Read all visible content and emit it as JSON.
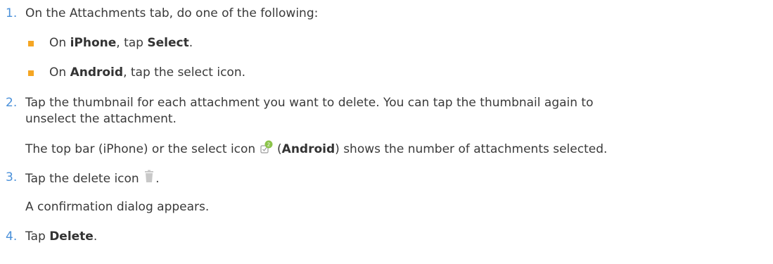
{
  "steps": [
    {
      "number": "1.",
      "text": "On the Attachments tab, do one of the following:",
      "sub": [
        {
          "pre": "On ",
          "bold": "iPhone",
          "mid": ", tap ",
          "bold2": "Select",
          "post": "."
        },
        {
          "pre": "On ",
          "bold": "Android",
          "post": ", tap the select icon."
        }
      ]
    },
    {
      "number": "2.",
      "line1": "Tap the thumbnail for each attachment you want to delete. You can tap the thumbnail again to",
      "line2": "unselect the attachment.",
      "note_pre": "The top bar (iPhone) or the select icon ",
      "note_paren_open": " (",
      "note_bold": "Android",
      "note_post": ") shows the number of attachments selected.",
      "badge_count": "2"
    },
    {
      "number": "3.",
      "text_pre": "Tap the delete icon ",
      "text_post": ".",
      "note": "A confirmation dialog appears."
    },
    {
      "number": "4.",
      "pre": "Tap ",
      "bold": "Delete",
      "post": "."
    }
  ],
  "colors": {
    "number": "#4a90d9",
    "bullet": "#f5a623",
    "badge": "#8bc34a",
    "trash": "#c8c8c8",
    "text": "#3a3a3a"
  }
}
